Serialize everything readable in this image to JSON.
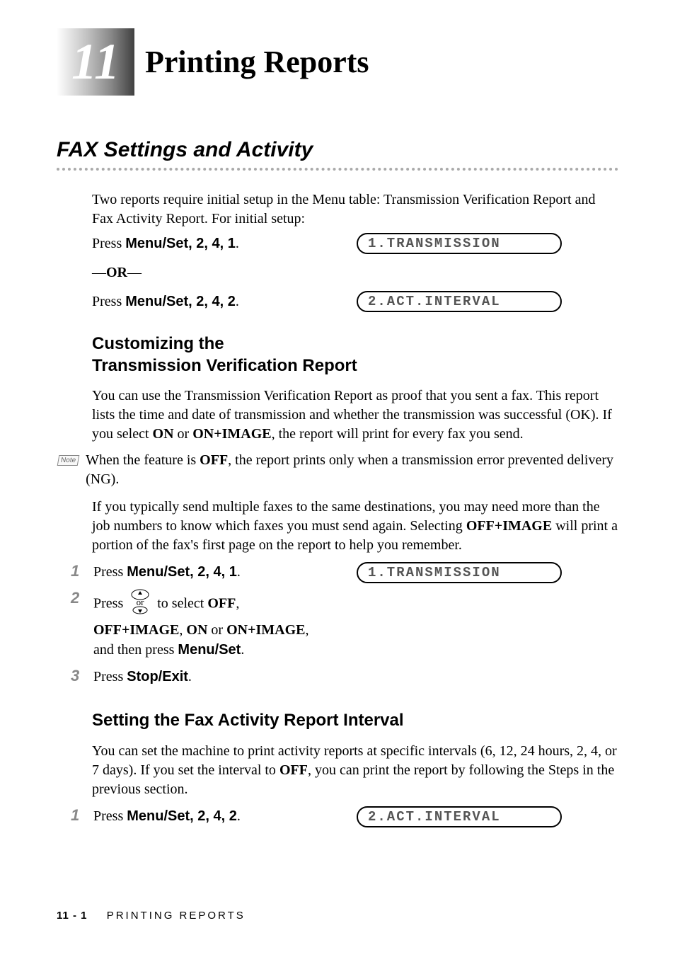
{
  "chapter": {
    "number": "11",
    "title": "Printing Reports"
  },
  "section": {
    "title": "FAX Settings and Activity"
  },
  "intro": "Two reports require initial setup in the Menu table: Transmission Verification Report and Fax Activity Report. For initial setup:",
  "setup": {
    "press1_label": "Press ",
    "press1_keys": "Menu/Set",
    "press1_nums": ", 2, 4, 1",
    "press1_period": ".",
    "lcd1": "1.TRANSMISSION",
    "or": "—OR—",
    "press2_label": "Press ",
    "press2_keys": "Menu/Set",
    "press2_nums": ", 2, 4, 2",
    "press2_period": ".",
    "lcd2": "2.ACT.INTERVAL"
  },
  "sub1": {
    "title_line1": "Customizing the",
    "title_line2": "Transmission Verification Report",
    "para1_a": "You can use the Transmission Verification Report as proof that you sent a fax. This report lists the time and date of transmission and whether the transmission was successful (OK). If you select ",
    "para1_on": "ON",
    "para1_or": " or ",
    "para1_onimage": "ON+IMAGE",
    "para1_b": ", the report will print for every fax you send.",
    "note_label": "Note",
    "note_a": "When the feature is ",
    "note_off": "OFF",
    "note_b": ", the report prints only when a transmission error prevented delivery (NG).",
    "para2_a": "If you typically send multiple faxes to the same destinations, you may need more than the job numbers to know which faxes you must send again. Selecting ",
    "para2_offimage": "OFF+IMAGE",
    "para2_b": " will print a portion of the fax's first page on the report to help you remember.",
    "step1_num": "1",
    "step1_a": "Press ",
    "step1_keys": "Menu/Set",
    "step1_nums": ", 2, 4, 1",
    "step1_period": ".",
    "step1_lcd": "1.TRANSMISSION",
    "step2_num": "2",
    "step2_a": "Press ",
    "step2_or": "or",
    "step2_b": " to select ",
    "step2_off": "OFF",
    "step2_comma": ",",
    "step2_line2_a": "OFF+IMAGE",
    "step2_line2_b": ", ",
    "step2_line2_c": "ON",
    "step2_line2_d": " or ",
    "step2_line2_e": "ON+IMAGE",
    "step2_line2_f": ",",
    "step2_line3_a": "and then press ",
    "step2_line3_b": "Menu/Set",
    "step2_line3_c": ".",
    "step3_num": "3",
    "step3_a": "Press ",
    "step3_b": "Stop/Exit",
    "step3_c": "."
  },
  "sub2": {
    "title": "Setting the Fax Activity Report Interval",
    "para1_a": "You can set the machine to print activity reports at specific intervals (6, 12, 24 hours, 2, 4, or 7 days). If you set the interval to ",
    "para1_off": "OFF",
    "para1_b": ", you can print the report by following the Steps in the previous section.",
    "step1_num": "1",
    "step1_a": "Press ",
    "step1_keys": "Menu/Set",
    "step1_nums": ", 2, 4, 2",
    "step1_period": ".",
    "step1_lcd": "2.ACT.INTERVAL"
  },
  "footer": {
    "page": "11 - 1",
    "label": "PRINTING REPORTS"
  }
}
